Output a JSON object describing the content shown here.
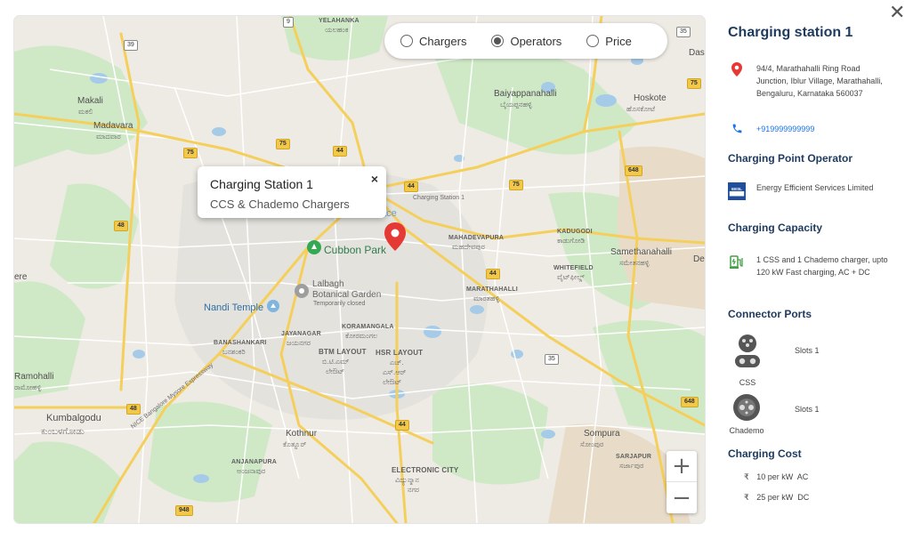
{
  "filter": {
    "options": [
      {
        "label": "Chargers",
        "selected": false
      },
      {
        "label": "Operators",
        "selected": true
      },
      {
        "label": "Price",
        "selected": false
      }
    ]
  },
  "infowindow": {
    "title": "Charging Station 1",
    "subtitle": "CCS & Chademo Chargers",
    "close": "×"
  },
  "map": {
    "marker_label": "Charging Station 1",
    "places": {
      "yelahanka": "YELAHANKA",
      "yelahanka_kn": "ಯಲಹಂಕ",
      "makali": "Makali",
      "makali_kn": "ಮಕಲಿ",
      "madavara": "Madavara",
      "madavara_kn": "ಮಾದವಾರ",
      "baiyappanahalli": "Baiyappanahalli",
      "baiyappanahalli_kn": "ಬೈಯಪ್ಪನಹಳ್ಳಿ",
      "hoskote": "Hoskote",
      "hoskote_kn": "ಹೊಸಕೋಟೆ",
      "cubbon_park": "Cubbon Park",
      "lalbagh": "Lalbagh",
      "lalbagh2": "Botanical Garden",
      "lalbagh_status": "Temporarily closed",
      "nandi_temple": "Nandi Temple",
      "mahadevapura": "MAHADEVAPURA",
      "mahadevapura_kn": "ಮಹದೇವಪುರ",
      "kadugodi": "KADUGODI",
      "kadugodi_kn": "ಕಾಡುಗೋಡಿ",
      "samethanahalli": "Samethanahalli",
      "samethanahalli_kn": "ಸಮೇತನಹಳ್ಳಿ",
      "whitefield": "WHITEFIELD",
      "whitefield_kn": "ವೈಟ್‌ಫೀಲ್ಡ್",
      "marathahalli": "MARATHAHALLI",
      "marathahalli_kn": "ಮಾರತಹಳ್ಳಿ",
      "koramangala": "KORAMANGALA",
      "koramangala_kn": "ಕೋರಮಂಗಲ",
      "jayanagar": "JAYANAGAR",
      "jayanagar_kn": "ಜಯನಗರ",
      "banashankari": "BANASHANKARI",
      "banashankari_kn": "ಬನಶಂಕರಿ",
      "btm": "BTM LAYOUT",
      "btm_kn1": "ಬಿ.ಟಿ.ಎಮ್",
      "btm_kn2": "ಲೇಔಟ್",
      "hsr": "HSR LAYOUT",
      "hsr_kn1": "ಎಚ್.",
      "hsr_kn2": "ಎಸ್.ಆರ್",
      "hsr_kn3": "ಲೇಔಟ್",
      "ramohalli": "Ramohalli",
      "ramohalli_kn": "ರಾಮೋಹಳ್ಳಿ",
      "kumbalgodu": "Kumbalgodu",
      "kumbalgodu_kn": "ಕುಂಬಳಗೋಡು",
      "kothnur": "Kothnur",
      "kothnur_kn": "ಕೊತ್ನೂರ್",
      "anjanapura": "ANJANAPURA",
      "anjanapura_kn": "ಅಂಜನಾಪುರ",
      "electronic_city": "ELECTRONIC CITY",
      "electronic_city_kn1": "ವಿದ್ಯುನ್ಮಾನ",
      "electronic_city_kn2": "ನಗರ",
      "sompura": "Sompura",
      "sompura_kn": "ಸೋಂಪುರ",
      "sarjapur": "SARJAPUR",
      "sarjapur_kn": "ಸರ್ಜಾಪುರ",
      "das": "Das",
      "de": "De",
      "ere": "ere",
      "nice_road": "NICE Bangalore Mysore Expressway",
      "ace": "ace"
    },
    "shields": [
      "9",
      "39",
      "35",
      "75",
      "75",
      "75",
      "44",
      "44",
      "75",
      "44",
      "648",
      "48",
      "44",
      "35",
      "648",
      "48",
      "44",
      "948",
      "648"
    ]
  },
  "zoom": {
    "in": "+",
    "out": "−"
  },
  "panel": {
    "close": "✕",
    "title": "Charging station 1",
    "address": "94/4, Marathahalli Ring Road Junction, Iblur Village, Marathahalli, Bengaluru, Karnataka 560037",
    "phone": "+919999999999",
    "operator_heading": "Charging Point Operator",
    "operator_name": "Energy Efficient Services Limited",
    "operator_logo_text": "EESL",
    "capacity_heading": "Charging Capacity",
    "capacity_text": "1 CSS and 1 Chademo charger, upto 120 kW Fast charging, AC + DC",
    "ports_heading": "Connector Ports",
    "ports": [
      {
        "name": "CSS",
        "slots": "Slots 1"
      },
      {
        "name": "Chademo",
        "slots": "Slots 1"
      }
    ],
    "cost_heading": "Charging Cost",
    "costs": [
      {
        "currency": "₹",
        "text": "10 per kW  AC"
      },
      {
        "currency": "₹",
        "text": "25 per kW  DC"
      }
    ],
    "colors": {
      "heading": "#1e3a5f",
      "link": "#1a73e8",
      "pin": "#e53935",
      "phone": "#1a73e8",
      "ev": "#43a047"
    }
  }
}
